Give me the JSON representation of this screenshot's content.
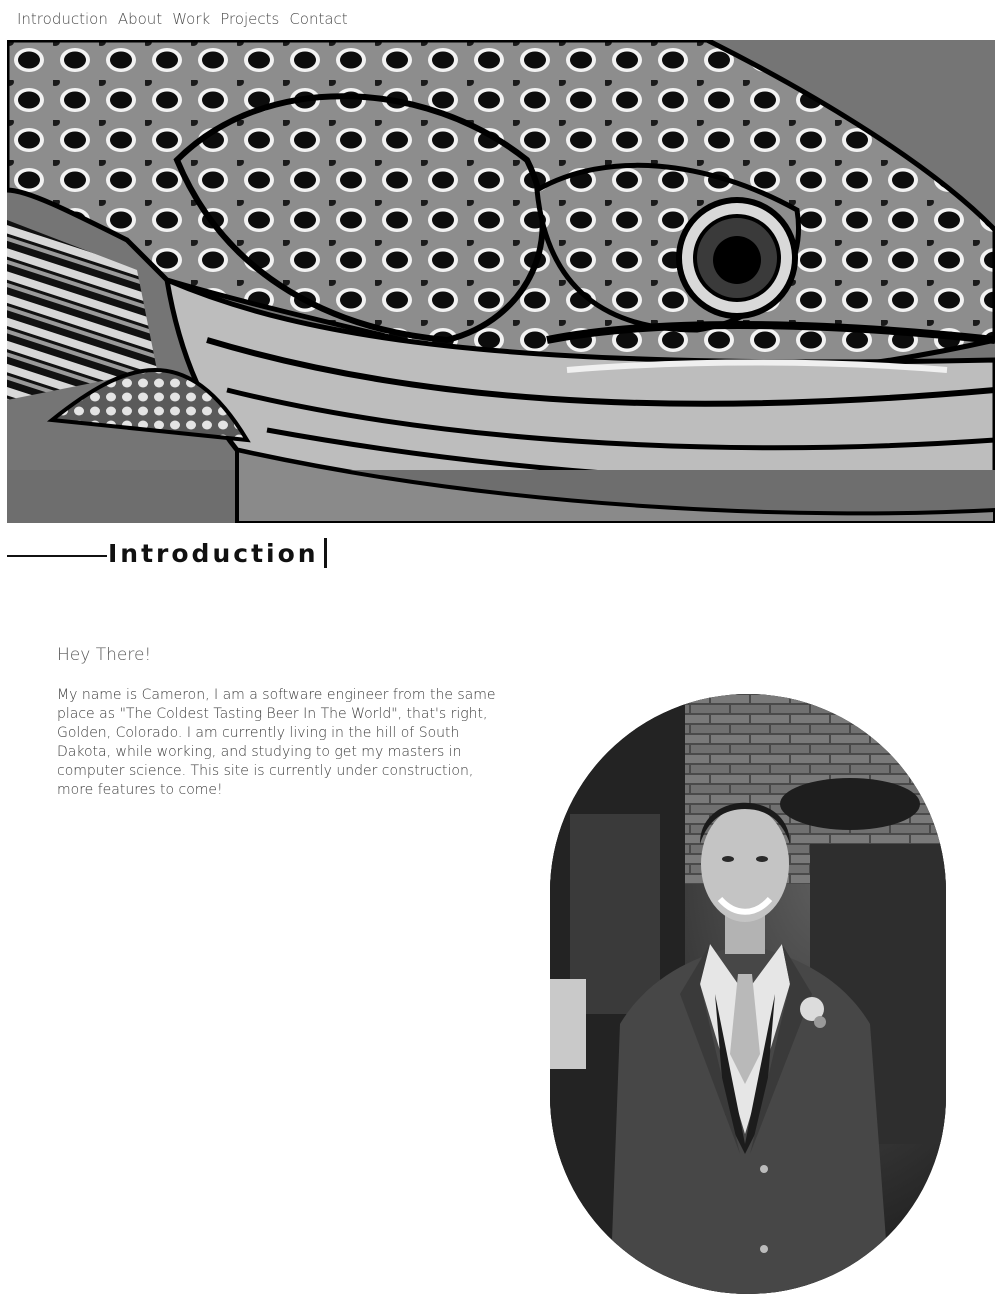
{
  "nav": {
    "items": [
      {
        "label": "Introduction"
      },
      {
        "label": "About"
      },
      {
        "label": "Work"
      },
      {
        "label": "Projects"
      },
      {
        "label": "Contact"
      }
    ]
  },
  "section": {
    "title": "Introduction"
  },
  "intro": {
    "greeting": "Hey There!",
    "bio": "My name is Cameron, I am a software engineer from the same place as \"The Coldest Tasting Beer In The World\", that's right, Golden, Colorado. I am currently living in the hill of South Dakota, while working, and studying to get my masters in computer science. This site is currently under construction, more features to come!"
  },
  "images": {
    "hero": "trout-painting",
    "portrait": "portrait-photo"
  },
  "colors": {
    "text": "#3c3c3c",
    "heading": "#111111",
    "background": "#ffffff"
  }
}
